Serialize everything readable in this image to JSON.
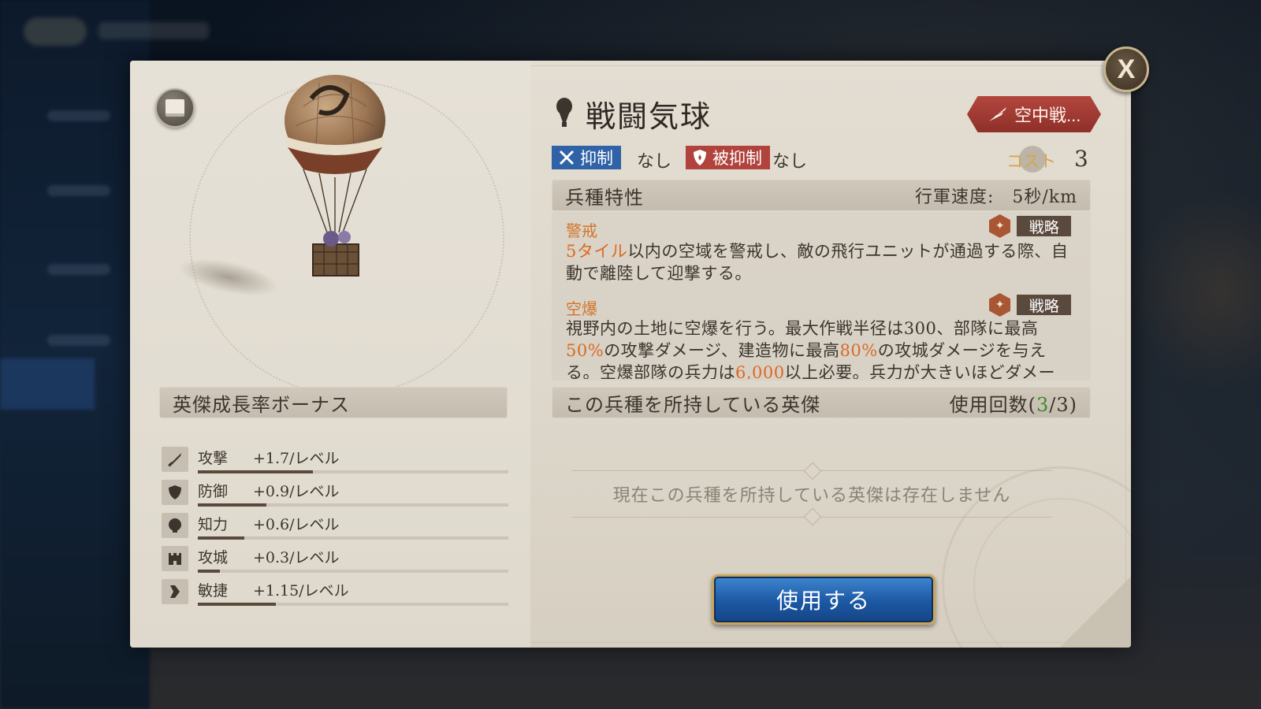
{
  "unit": {
    "name": "戦闘気球",
    "type_tag": "空中戦...",
    "suppress_label": "抑制",
    "suppress_value": "なし",
    "suppressed_label": "被抑制",
    "suppressed_value": "なし",
    "cost_label": "コスト",
    "cost_value": "3"
  },
  "traits_section": {
    "title": "兵種特性",
    "march_speed": "行軍速度:　5秒/km"
  },
  "traits": [
    {
      "name": "警戒",
      "tag": "戦略",
      "desc_parts": [
        "5タイル",
        "以内の空域を警戒し、敵の飛行ユニットが通過する際、自動で離陸して迎撃する。"
      ]
    },
    {
      "name": "空爆",
      "tag": "戦略",
      "desc_parts": [
        "視野内の土地に空爆を行う。最大作戦半径は300、部隊に最高",
        "50%",
        "の攻撃ダメージ、建造物に最高",
        "80%",
        "の攻城ダメージを与える。空爆部隊の兵力は",
        "6,000",
        "以上必要。兵力が大きいほどダメー"
      ]
    }
  ],
  "heroes_section": {
    "title": "この兵種を所持している英傑",
    "usage_prefix": "使用回数(",
    "usage_current": "3",
    "usage_suffix": "/3)",
    "empty_message": "現在この兵種を所持している英傑は存在しません"
  },
  "growth": {
    "title": "英傑成長率ボーナス",
    "stats": [
      {
        "name": "攻撃",
        "value": "+1.7/レベル",
        "icon": "sword-icon",
        "fill": 0.37
      },
      {
        "name": "防御",
        "value": "+0.9/レベル",
        "icon": "shield-icon",
        "fill": 0.22
      },
      {
        "name": "知力",
        "value": "+0.6/レベル",
        "icon": "head-icon",
        "fill": 0.15
      },
      {
        "name": "攻城",
        "value": "+0.3/レベル",
        "icon": "castle-icon",
        "fill": 0.07
      },
      {
        "name": "敏捷",
        "value": "+1.15/レベル",
        "icon": "boot-icon",
        "fill": 0.25
      }
    ]
  },
  "actions": {
    "use_label": "使用する",
    "close_label": "X"
  },
  "colors": {
    "highlight": "#d96a24",
    "count_green": "#3d8a2a",
    "suppress_blue": "#2f62a6",
    "suppressed_red": "#b1433c",
    "use_button": "#1c58a3"
  }
}
